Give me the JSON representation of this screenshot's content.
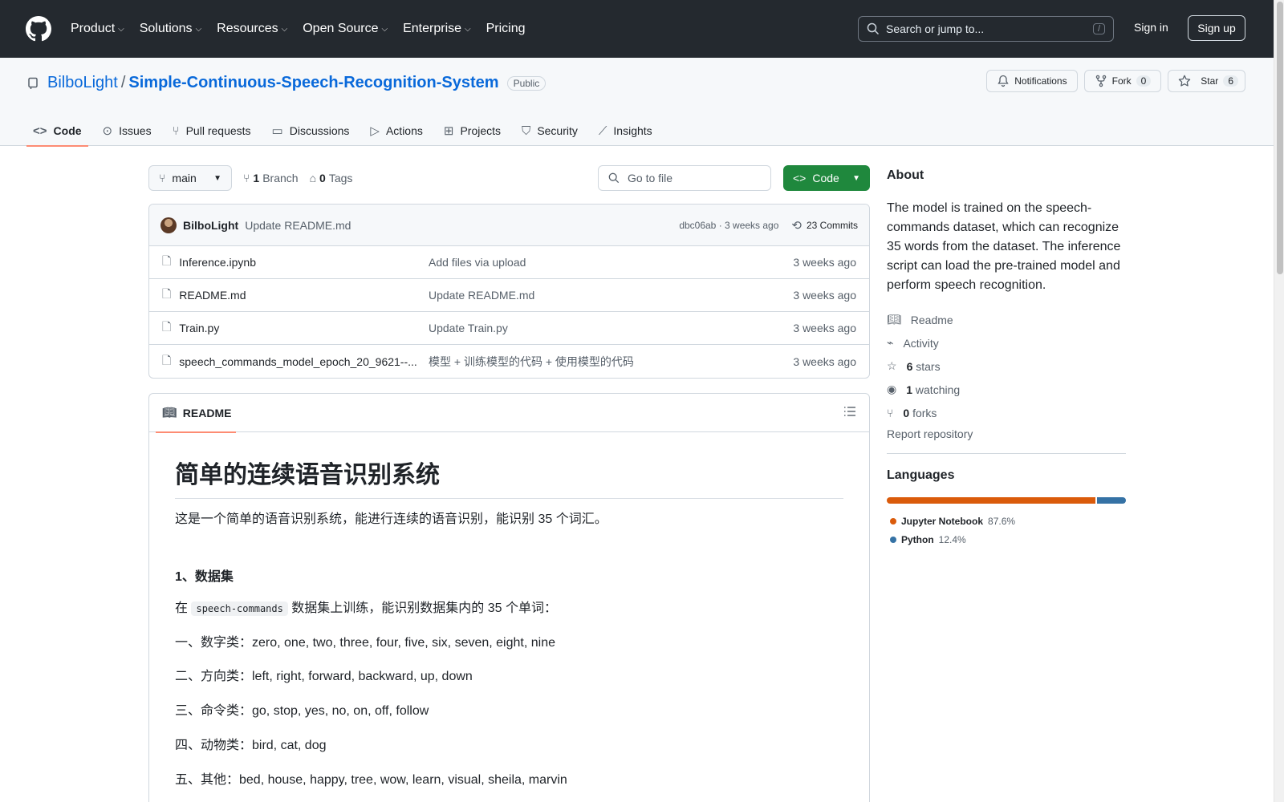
{
  "header": {
    "nav": [
      "Product",
      "Solutions",
      "Resources",
      "Open Source",
      "Enterprise",
      "Pricing"
    ],
    "search_placeholder": "Search or jump to...",
    "search_shortcut": "/",
    "signin": "Sign in",
    "signup": "Sign up"
  },
  "repo": {
    "owner": "BilboLight",
    "separator": "/",
    "name": "Simple-Continuous-Speech-Recognition-System",
    "visibility": "Public",
    "notifications": "Notifications",
    "fork_label": "Fork",
    "fork_count": "0",
    "star_label": "Star",
    "star_count": "6"
  },
  "tabs": [
    "Code",
    "Issues",
    "Pull requests",
    "Discussions",
    "Actions",
    "Projects",
    "Security",
    "Insights"
  ],
  "toolbar": {
    "branch": "main",
    "branch_count": "1",
    "branch_label": "Branch",
    "tag_count": "0",
    "tag_label": "Tags",
    "goto_placeholder": "Go to file",
    "code_button": "Code"
  },
  "commit": {
    "user": "BilboLight",
    "message": "Update README.md",
    "meta": "dbc06ab · 3 weeks ago",
    "count": "23 Commits"
  },
  "files": [
    {
      "name": "Inference.ipynb",
      "message": "Add files via upload",
      "time": "3 weeks ago"
    },
    {
      "name": "README.md",
      "message": "Update README.md",
      "time": "3 weeks ago"
    },
    {
      "name": "Train.py",
      "message": "Update Train.py",
      "time": "3 weeks ago"
    },
    {
      "name": "speech_commands_model_epoch_20_9621--...",
      "message": "模型 + 训练模型的代码 + 使用模型的代码",
      "time": "3 weeks ago"
    }
  ],
  "readme": {
    "tab": "README",
    "title": "简单的连续语音识别系统",
    "intro": "这是一个简单的语音识别系统，能进行连续的语音识别，能识别 35 个词汇。",
    "section1": "1、数据集",
    "dataset_pre": "在",
    "dataset_code": "speech-commands",
    "dataset_post": "数据集上训练，能识别数据集内的 35 个单词：",
    "lines": [
      "一、数字类：zero, one, two, three, four, five, six, seven, eight, nine",
      "二、方向类：left, right, forward, backward, up, down",
      "三、命令类：go, stop, yes, no, on, off, follow",
      "四、动物类：bird, cat, dog",
      "五、其他：bed, house, happy, tree, wow, learn, visual, sheila, marvin"
    ]
  },
  "sidebar": {
    "about_title": "About",
    "about_text": "The model is trained on the speech-commands dataset, which can recognize 35 words from the dataset. The inference script can load the pre-trained model and perform speech recognition.",
    "readme": "Readme",
    "activity": "Activity",
    "stars_count": "6",
    "stars_label": "stars",
    "watching_count": "1",
    "watching_label": "watching",
    "forks_count": "0",
    "forks_label": "forks",
    "report": "Report repository",
    "languages_title": "Languages",
    "languages": [
      {
        "name": "Jupyter Notebook",
        "percent": "87.6%",
        "value": 87.6,
        "color": "#DA5B0B"
      },
      {
        "name": "Python",
        "percent": "12.4%",
        "value": 12.4,
        "color": "#3572A5"
      }
    ]
  },
  "colors": {
    "header_bg": "#24292f",
    "link": "#0969da",
    "primary_button": "#1f883d",
    "tab_underline": "#fd8c73"
  }
}
